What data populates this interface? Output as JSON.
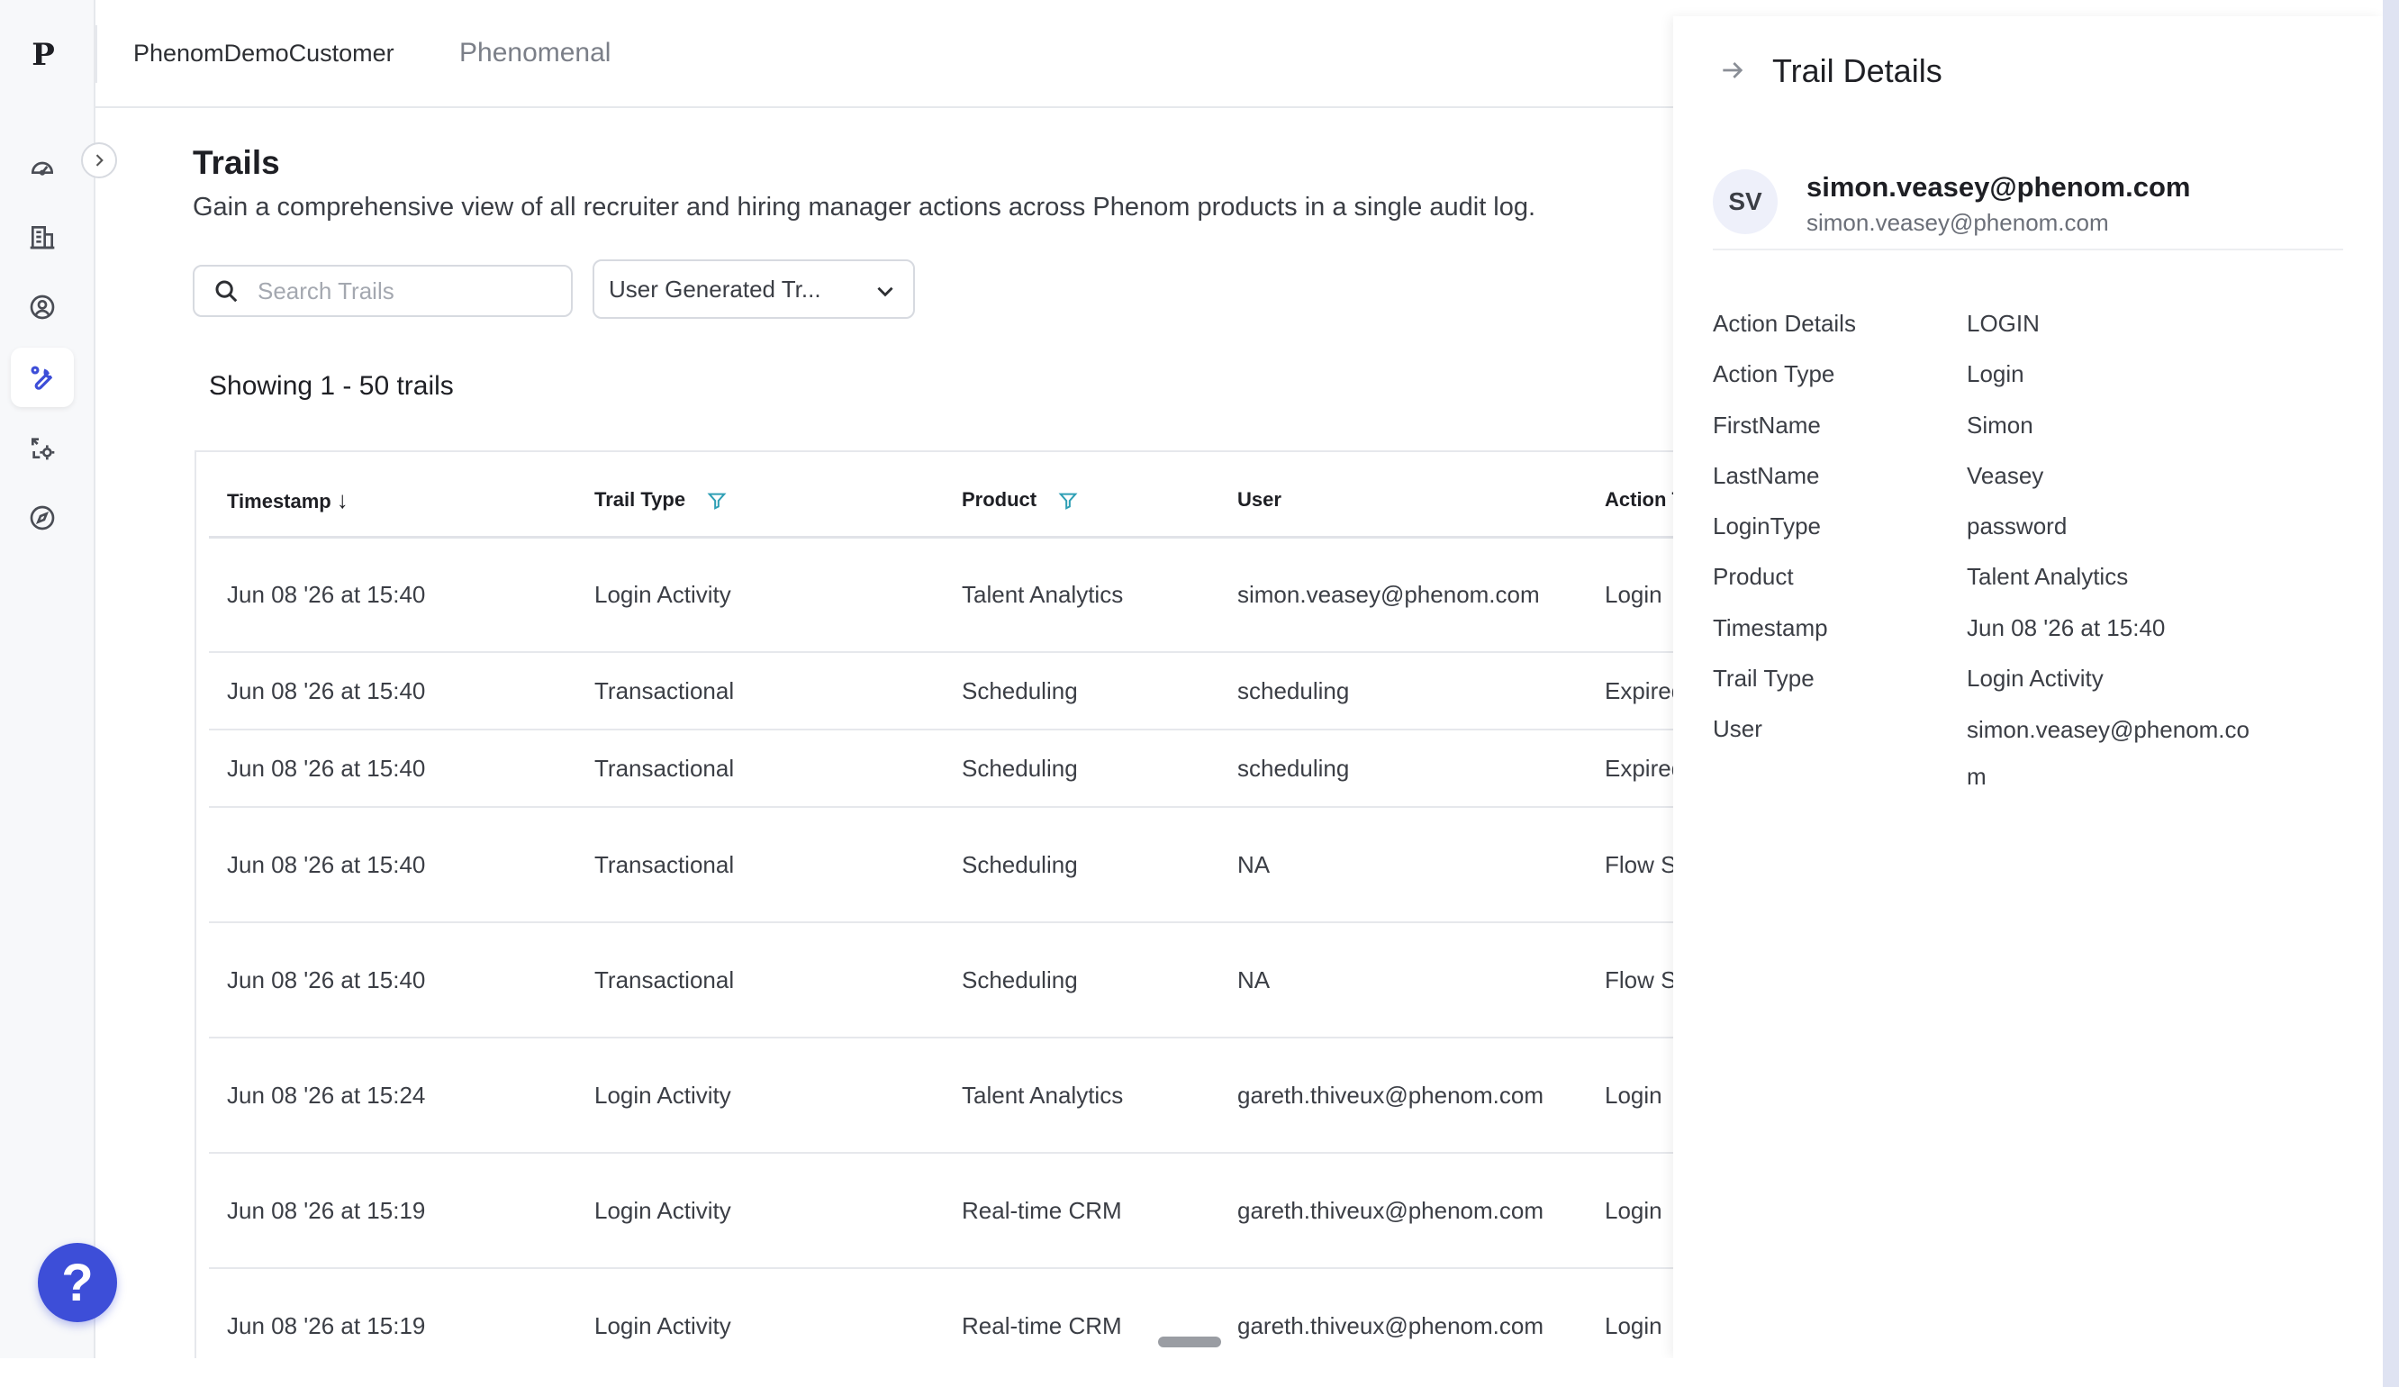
{
  "app": {
    "logo_text": "P",
    "org_name": "PhenomDemoCustomer",
    "org_alt": "Phenomenal"
  },
  "rail": {
    "items": [
      {
        "icon": "dashboard-icon",
        "active": false
      },
      {
        "icon": "building-icon",
        "active": false
      },
      {
        "icon": "user-circle-icon",
        "active": false
      },
      {
        "icon": "wrench-icon",
        "active": true
      },
      {
        "icon": "sync-settings-icon",
        "active": false
      },
      {
        "icon": "compass-icon",
        "active": false
      }
    ],
    "help_label": "?"
  },
  "page": {
    "title": "Trails",
    "description": "Gain a comprehensive view of all recruiter and hiring manager actions across Phenom products in a single audit log.",
    "search_placeholder": "Search Trails",
    "filter_value": "User Generated Tr...",
    "showing": "Showing 1 - 50 trails"
  },
  "table": {
    "columns": [
      "Timestamp",
      "Trail Type",
      "Product",
      "User",
      "Action Type"
    ],
    "sort_indicator": "↓",
    "rows": [
      {
        "timestamp": "Jun 08 '26 at 15:40",
        "trail_type": "Login Activity",
        "product": "Talent Analytics",
        "user": "simon.veasey@phenom.com",
        "action": "Login",
        "size": "tall"
      },
      {
        "timestamp": "Jun 08 '26 at 15:40",
        "trail_type": "Transactional",
        "product": "Scheduling",
        "user": "scheduling",
        "action": "Expired",
        "size": "short"
      },
      {
        "timestamp": "Jun 08 '26 at 15:40",
        "trail_type": "Transactional",
        "product": "Scheduling",
        "user": "scheduling",
        "action": "Expired",
        "size": "short"
      },
      {
        "timestamp": "Jun 08 '26 at 15:40",
        "trail_type": "Transactional",
        "product": "Scheduling",
        "user": "NA",
        "action": "Flow Started",
        "size": "tall"
      },
      {
        "timestamp": "Jun 08 '26 at 15:40",
        "trail_type": "Transactional",
        "product": "Scheduling",
        "user": "NA",
        "action": "Flow Started",
        "size": "tall"
      },
      {
        "timestamp": "Jun 08 '26 at 15:24",
        "trail_type": "Login Activity",
        "product": "Talent Analytics",
        "user": "gareth.thiveux@phenom.com",
        "action": "Login",
        "size": "tall"
      },
      {
        "timestamp": "Jun 08 '26 at 15:19",
        "trail_type": "Login Activity",
        "product": "Real-time CRM",
        "user": "gareth.thiveux@phenom.com",
        "action": "Login",
        "size": "tall"
      },
      {
        "timestamp": "Jun 08 '26 at 15:19",
        "trail_type": "Login Activity",
        "product": "Real-time CRM",
        "user": "gareth.thiveux@phenom.com",
        "action": "Login",
        "size": "tall"
      }
    ]
  },
  "panel": {
    "title": "Trail Details",
    "avatar_initials": "SV",
    "user_name": "simon.veasey@phenom.com",
    "user_email": "simon.veasey@phenom.com",
    "details": [
      {
        "key": "Action Details",
        "value": "LOGIN"
      },
      {
        "key": "Action Type",
        "value": "Login"
      },
      {
        "key": "FirstName",
        "value": "Simon"
      },
      {
        "key": "LastName",
        "value": "Veasey"
      },
      {
        "key": "LoginType",
        "value": "password"
      },
      {
        "key": "Product",
        "value": "Talent Analytics"
      },
      {
        "key": "Timestamp",
        "value": "Jun 08 '26 at 15:40"
      },
      {
        "key": "Trail Type",
        "value": "Login Activity"
      },
      {
        "key": "User",
        "value": "simon.veasey@phenom.com"
      }
    ]
  },
  "colors": {
    "accent": "#3d4ed8",
    "filter_icon": "#2e9fb5"
  }
}
